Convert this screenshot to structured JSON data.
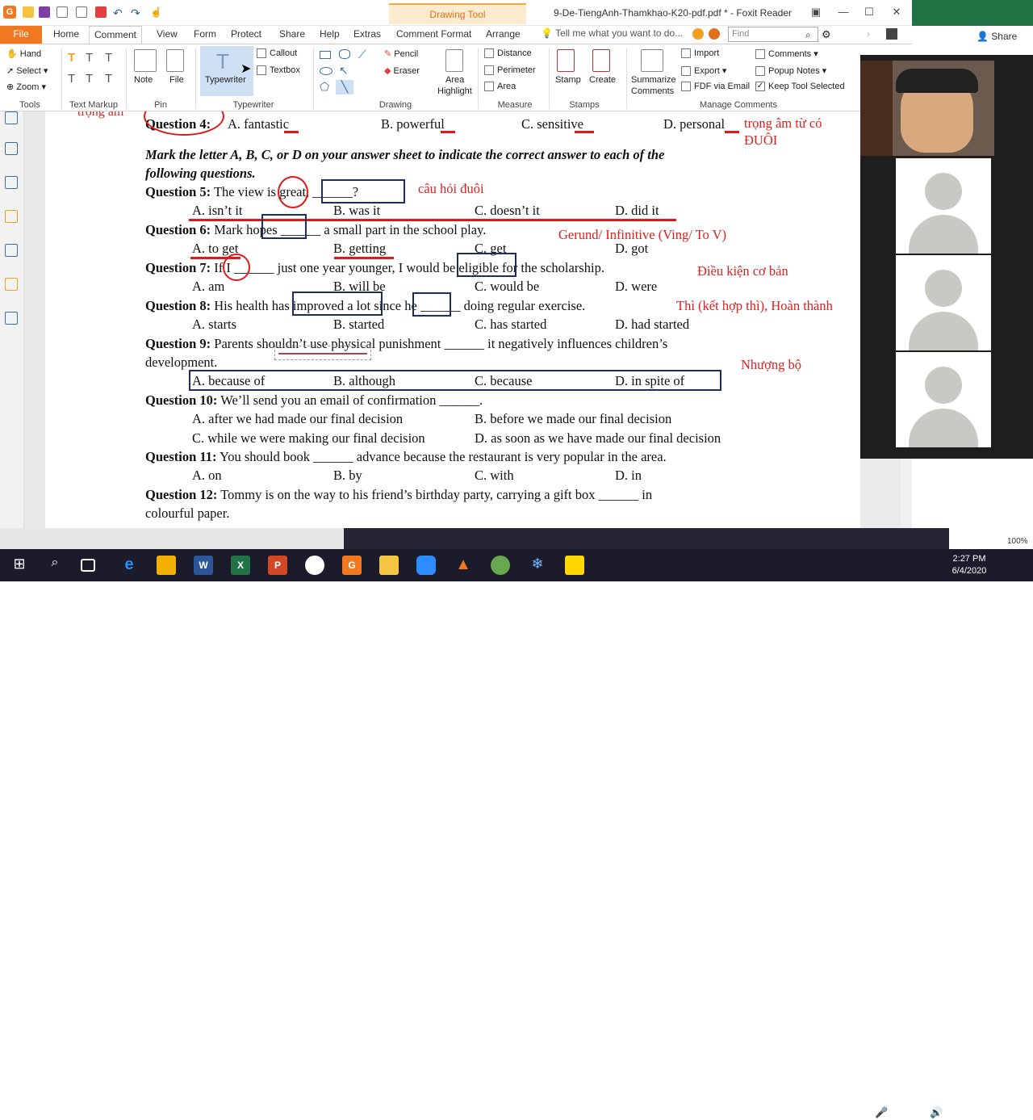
{
  "titlebar": {
    "drawing_tool": "Drawing Tool",
    "doc_title": "9-De-TiengAnh-Thamkhao-K20-pdf.pdf * - Foxit Reader",
    "minimize": "—",
    "maximize": "☐",
    "close": "✕"
  },
  "menu": {
    "file": "File",
    "tabs": [
      "Home",
      "Comment",
      "View",
      "Form",
      "Protect",
      "Share",
      "Help",
      "Extras",
      "Comment Format",
      "Arrange"
    ],
    "tell_me": "Tell me what you want to do...",
    "find_placeholder": "Find",
    "share": "Share"
  },
  "ribbon": {
    "tools": {
      "hand": "Hand",
      "select": "Select",
      "zoom": "Zoom",
      "label": "Tools"
    },
    "text_markup": {
      "label": "Text Markup"
    },
    "pin": {
      "note": "Note",
      "file": "File",
      "label": "Pin"
    },
    "typewriter": {
      "typewriter": "Typewriter",
      "callout": "Callout",
      "textbox": "Textbox",
      "label": "Typewriter"
    },
    "drawing": {
      "pencil": "Pencil",
      "eraser": "Eraser",
      "area_highlight_1": "Area",
      "area_highlight_2": "Highlight",
      "label": "Drawing"
    },
    "measure": {
      "distance": "Distance",
      "perimeter": "Perimeter",
      "area": "Area",
      "label": "Measure"
    },
    "stamps": {
      "stamp": "Stamp",
      "create": "Create",
      "label": "Stamps"
    },
    "manage": {
      "summarize_1": "Summarize",
      "summarize_2": "Comments",
      "import": "Import",
      "export": "Export",
      "fdf": "FDF via Email",
      "comments": "Comments",
      "popup_notes": "Popup Notes",
      "keep_tool": "Keep Tool Selected",
      "label": "Manage Comments"
    }
  },
  "document": {
    "top_cut": "trọng âm",
    "q4": {
      "label": "Question 4:",
      "a": "A. fantastic",
      "b": "B. powerful",
      "c": "C. sensitive",
      "d": "D. personal",
      "note1": "trọng âm từ có",
      "note2": "ĐUÔI"
    },
    "instruction1": "Mark the letter A, B, C, or D on your answer sheet to indicate the correct answer to each of the",
    "instruction2": "following questions.",
    "q5": {
      "label": "Question 5:",
      "text": "The view is great, ______?",
      "a": "A. isn’t it",
      "b": "B. was it",
      "c": "C. doesn’t it",
      "d": "D. did it",
      "note": "câu hỏi đuôi"
    },
    "q6": {
      "label": "Question 6:",
      "text": "Mark hopes ______ a small part in the school play.",
      "a": "A. to get",
      "b": "B. getting",
      "c": "C. get",
      "d": "D. got",
      "note": "Gerund/ Infinitive (Ving/ To V)"
    },
    "q7": {
      "label": "Question 7:",
      "text": "If I ______ just one year younger, I would be eligible for the scholarship.",
      "a": "A. am",
      "b": "B. will be",
      "c": "C. would be",
      "d": "D. were",
      "note": "Điều kiện cơ bản"
    },
    "q8": {
      "label": "Question 8:",
      "text": "His health has improved a lot since he ______ doing regular exercise.",
      "a": "A. starts",
      "b": "B. started",
      "c": "C. has started",
      "d": "D. had started",
      "note": "Thì (kết hợp thì), Hoàn thành"
    },
    "q9": {
      "label": "Question 9:",
      "text": "Parents shouldn’t use physical punishment ______ it negatively influences children’s",
      "text2": "development.",
      "a": "A. because of",
      "b": "B. although",
      "c": "C. because",
      "d": "D. in spite of",
      "note": "Nhượng bộ"
    },
    "q10": {
      "label": "Question 10:",
      "text": "We’ll send you an email of confirmation ______.",
      "a": "A. after we had made our final decision",
      "b": "B. before we made our final decision",
      "c": "C. while we were making our final decision",
      "d": "D. as soon as we have made our final decision"
    },
    "q11": {
      "label": "Question 11:",
      "text": "You should book ______ advance because the restaurant is very popular in the area.",
      "a": "A. on",
      "b": "B. by",
      "c": "C. with",
      "d": "D. in"
    },
    "q12": {
      "label": "Question 12:",
      "text": "Tommy is on the way to his friend’s birthday party, carrying a gift box ______ in",
      "text2": "colourful paper."
    }
  },
  "taskbar": {
    "time": "2:27 PM",
    "date": "6/4/2020",
    "zoom": "100%"
  },
  "colors": {
    "accent": "#f07820",
    "annotation_red": "#e01818",
    "box_navy": "#1f2d5c"
  }
}
